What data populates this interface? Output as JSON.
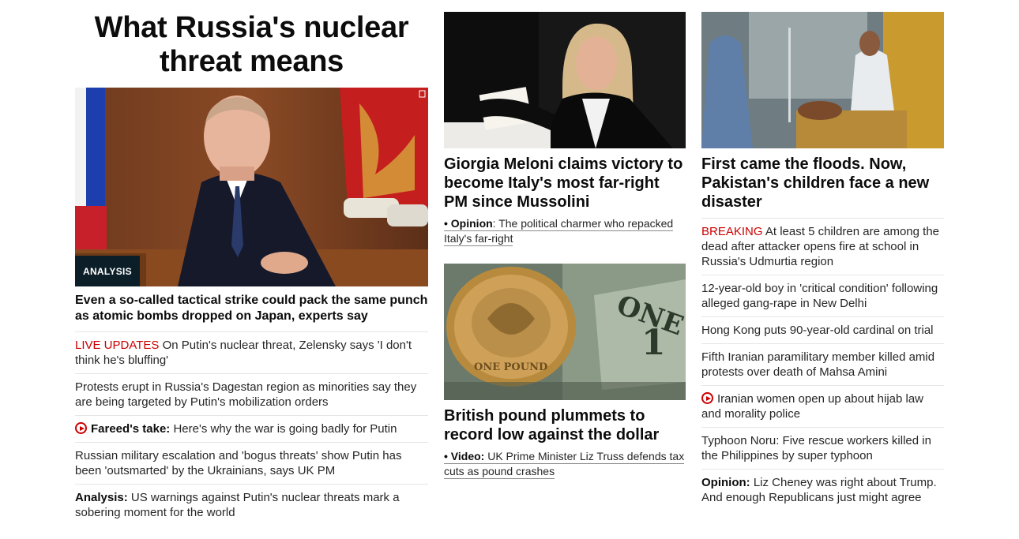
{
  "col1": {
    "title": "What Russia's nuclear threat means",
    "badge": "ANALYSIS",
    "lead": "Even a so-called tactical strike could pack the same punch as atomic bombs dropped on Japan, experts say",
    "items": [
      {
        "prefix": "LIVE UPDATES",
        "text": " On Putin's nuclear threat, Zelensky says 'I don't think he's bluffing'"
      },
      {
        "text": "Protests erupt in Russia's Dagestan region as minorities say they are being targeted by Putin's mobilization orders"
      },
      {
        "prefix": "Fareed's take:",
        "text": " Here's why the war is going badly for Putin"
      },
      {
        "text": "Russian military escalation and 'bogus threats' show Putin has been 'outsmarted' by the Ukrainians, says UK PM"
      },
      {
        "prefix": "Analysis:",
        "text": " US warnings against Putin's nuclear threats mark a sobering moment for the world"
      }
    ]
  },
  "col2": {
    "story1": {
      "headline": "Giorgia Meloni claims victory to become Italy's most far-right PM since Mussolini",
      "sub_prefix": "• Opinion",
      "sub_text": ": The political charmer who repacked Italy's far-right"
    },
    "story2": {
      "headline": "British pound plummets to record low against the dollar",
      "sub_prefix": "• Video:",
      "sub_text": " UK Prime Minister Liz Truss defends tax cuts as pound crashes"
    }
  },
  "col3": {
    "headline": "First came the floods. Now, Pakistan's children face a new disaster",
    "items": [
      {
        "prefix": "BREAKING",
        "text": " At least 5 children are among the dead after attacker opens fire at school in Russia's Udmurtia region"
      },
      {
        "text": "12-year-old boy in 'critical condition' following alleged gang-rape in New Delhi"
      },
      {
        "text": "Hong Kong puts 90-year-old cardinal on trial"
      },
      {
        "text": "Fifth Iranian paramilitary member killed amid protests over death of Mahsa Amini"
      },
      {
        "text": "Iranian women open up about hijab law and morality police"
      },
      {
        "text": "Typhoon Noru: Five rescue workers killed in the Philippines by super typhoon"
      },
      {
        "prefix": "Opinion:",
        "text": " Liz Cheney was right about Trump. And enough Republicans just might agree"
      }
    ]
  },
  "colors": {
    "accent_red": "#cc0000",
    "badge_bg": "#0c1e28"
  }
}
